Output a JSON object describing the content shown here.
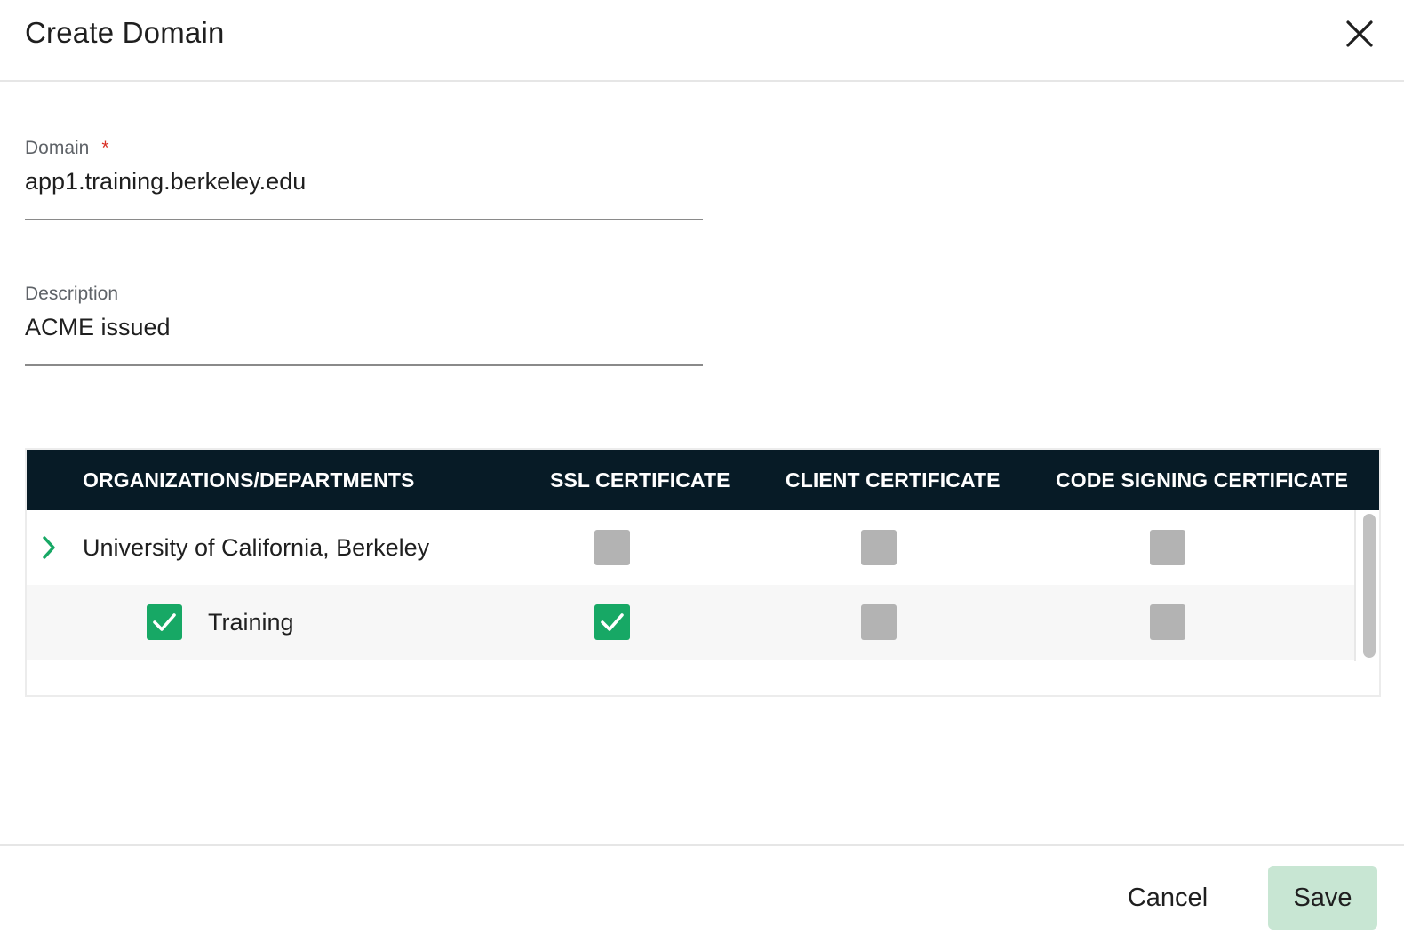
{
  "dialog": {
    "title": "Create Domain",
    "close_icon": "close-icon"
  },
  "form": {
    "domain": {
      "label": "Domain",
      "required_mark": "*",
      "value": "app1.training.berkeley.edu"
    },
    "description": {
      "label": "Description",
      "value": "ACME issued"
    }
  },
  "table": {
    "headers": {
      "org": "ORGANIZATIONS/DEPARTMENTS",
      "ssl": "SSL CERTIFICATE",
      "client": "CLIENT CERTIFICATE",
      "code_signing": "CODE SIGNING CERTIFICATE"
    },
    "rows": [
      {
        "name": "University of California, Berkeley",
        "expand_icon": "chevron-right-icon",
        "ssl_checked": false,
        "client_checked": false,
        "code_signing_checked": false
      },
      {
        "name": "Training",
        "selected": true,
        "ssl_checked": true,
        "client_checked": false,
        "code_signing_checked": false
      }
    ]
  },
  "footer": {
    "cancel_label": "Cancel",
    "save_label": "Save"
  },
  "colors": {
    "header_bg": "#071b26",
    "accent_green": "#17a865",
    "save_bg": "#c8e6d3",
    "required": "#d93025",
    "checkbox_off": "#b3b3b3"
  }
}
